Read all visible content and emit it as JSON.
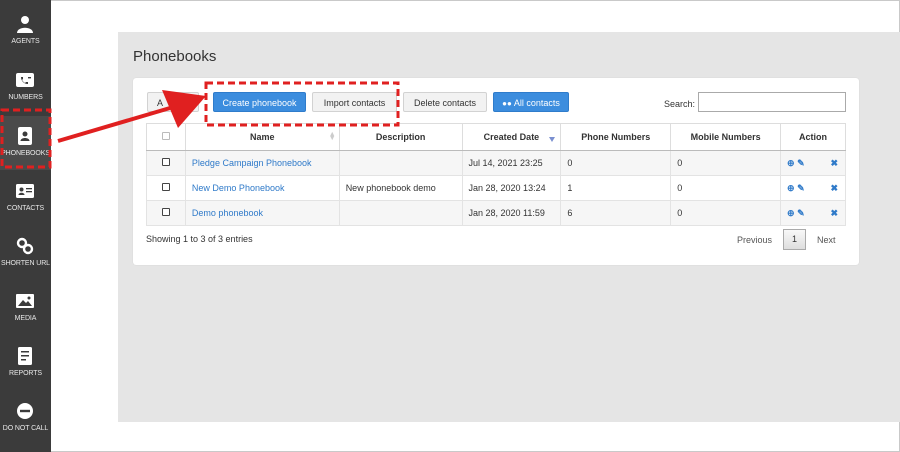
{
  "sidebar": {
    "items": [
      {
        "label": "AGENTS",
        "icon": "agent-icon"
      },
      {
        "label": "NUMBERS",
        "icon": "phone-card-icon"
      },
      {
        "label": "PHONEBOOKS",
        "icon": "phonebook-icon"
      },
      {
        "label": "CONTACTS",
        "icon": "contact-card-icon"
      },
      {
        "label": "SHORTEN URL",
        "icon": "link-icon"
      },
      {
        "label": "MEDIA",
        "icon": "image-icon"
      },
      {
        "label": "REPORTS",
        "icon": "report-icon"
      },
      {
        "label": "DO NOT CALL",
        "icon": "minus-circle-icon"
      }
    ]
  },
  "page": {
    "title": "Phonebooks"
  },
  "toolbar": {
    "partial_label": "A",
    "create_label": "Create phonebook",
    "import_label": "Import contacts",
    "delete_label": "Delete contacts",
    "all_contacts_label": "All contacts"
  },
  "search": {
    "label": "Search:",
    "value": ""
  },
  "table": {
    "columns": [
      "",
      "Name",
      "Description",
      "Created Date",
      "Phone Numbers",
      "Mobile Numbers",
      "Action"
    ],
    "rows": [
      {
        "name": "Pledge Campaign Phonebook",
        "description": "",
        "created": "Jul 14, 2021 23:25",
        "phone": "0",
        "mobile": "0"
      },
      {
        "name": "New Demo Phonebook",
        "description": "New phonebook demo",
        "created": "Jan 28, 2020 13:24",
        "phone": "1",
        "mobile": "0"
      },
      {
        "name": "Demo phonebook",
        "description": "",
        "created": "Jan 28, 2020 11:59",
        "phone": "6",
        "mobile": "0"
      }
    ]
  },
  "footer": {
    "info": "Showing 1 to 3 of 3 entries",
    "previous": "Previous",
    "current_page": "1",
    "next": "Next"
  },
  "colors": {
    "sidebar_bg": "#3b3b3b",
    "primary_button": "#3c8dde",
    "link": "#2f7ac9",
    "annotation_red": "#e02020"
  }
}
